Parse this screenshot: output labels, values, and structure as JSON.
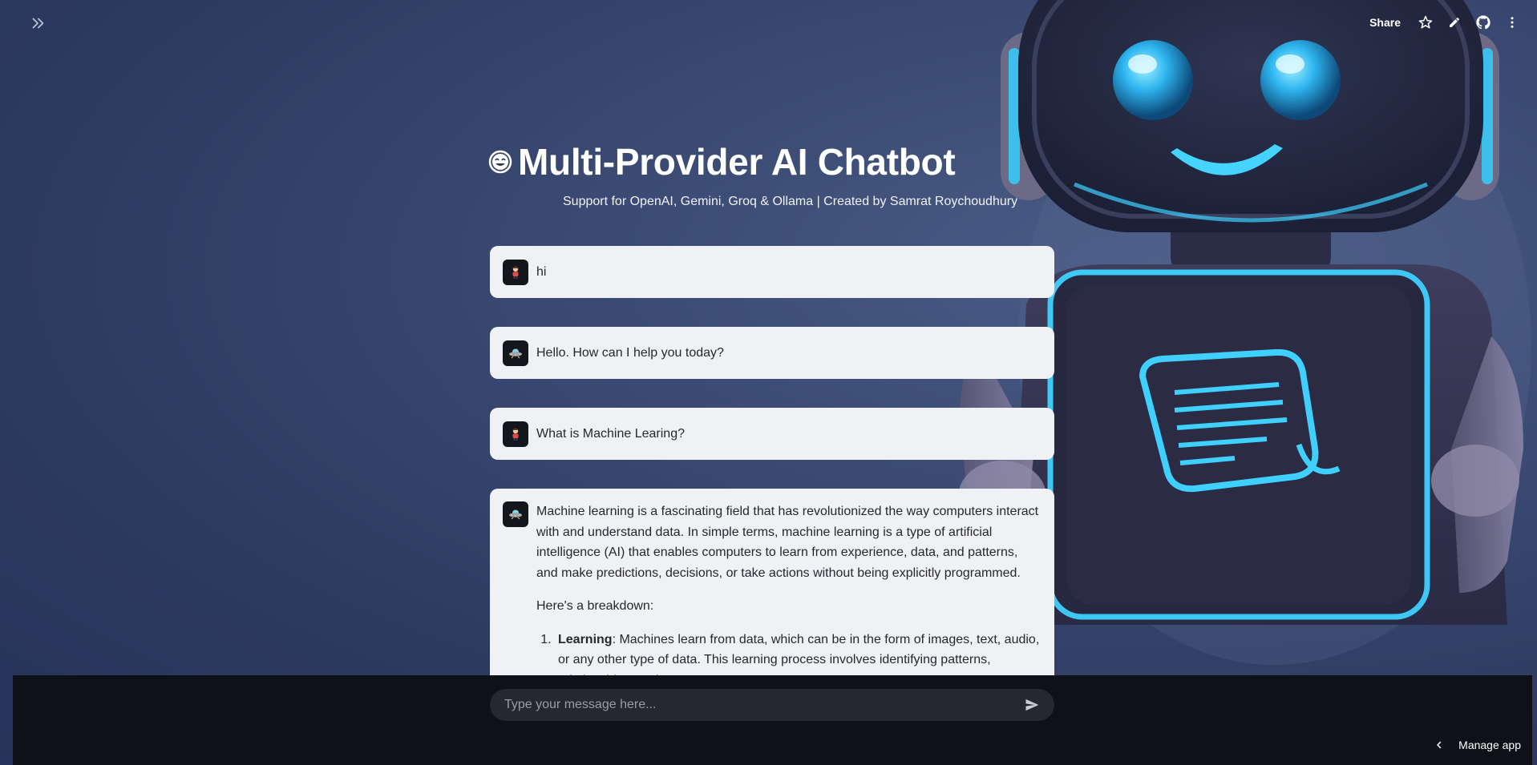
{
  "app": {
    "title_emoji": "😊",
    "title": "Multi-Provider AI Chatbot",
    "subtitle": "Support for OpenAI, Gemini, Groq & Ollama | Created by Samrat Roychoudhury"
  },
  "toolbar": {
    "share_label": "Share",
    "icons": [
      "star-icon",
      "edit-icon",
      "github-icon",
      "more-icon"
    ]
  },
  "sidebar_toggle_icon": "double-chevron-right-icon",
  "messages": [
    {
      "role": "user",
      "avatar_icon": "user-avatar-icon",
      "text": "hi"
    },
    {
      "role": "assistant",
      "avatar_icon": "assistant-avatar-icon",
      "text": "Hello. How can I help you today?"
    },
    {
      "role": "user",
      "avatar_icon": "user-avatar-icon",
      "text": "What is Machine Learing?"
    },
    {
      "role": "assistant",
      "avatar_icon": "assistant-avatar-icon",
      "paragraph": "Machine learning is a fascinating field that has revolutionized the way computers interact with and understand data. In simple terms, machine learning is a type of artificial intelligence (AI) that enables computers to learn from experience, data, and patterns, and make predictions, decisions, or take actions without being explicitly programmed.",
      "intro": "Here's a breakdown:",
      "list": [
        {
          "term": "Learning",
          "text": ": Machines learn from data, which can be in the form of images, text, audio, or any other type of data. This learning process involves identifying patterns, relationships, and"
        }
      ]
    }
  ],
  "chat_input": {
    "placeholder": "Type your message here...",
    "value": ""
  },
  "manage_app_label": "Manage app",
  "colors": {
    "background": "#2d3a60",
    "bubble": "#f0f1f5",
    "input_bg": "#262730",
    "bottom_bar": "#0e1117",
    "accent_glow": "#3fd0ff"
  }
}
